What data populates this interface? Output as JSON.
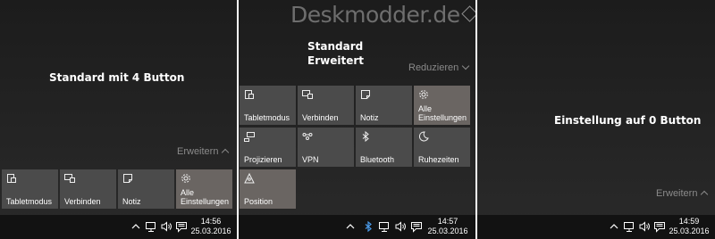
{
  "watermark": "Deskmodder.de",
  "panel1": {
    "caption": "Standard mit 4 Button",
    "expand_label": "Erweitern",
    "tiles": [
      "Tabletmodus",
      "Verbinden",
      "Notiz",
      "Alle Einstellungen"
    ],
    "clock": {
      "time": "14:56",
      "date": "25.03.2016"
    }
  },
  "panel2": {
    "caption_line1": "Standard",
    "caption_line2": "Erweitert",
    "collapse_label": "Reduzieren",
    "tiles": [
      "Tabletmodus",
      "Verbinden",
      "Notiz",
      "Alle Einstellungen",
      "Projizieren",
      "VPN",
      "Bluetooth",
      "Ruhezeiten",
      "Position"
    ],
    "clock": {
      "time": "14:57",
      "date": "25.03.2016"
    }
  },
  "panel3": {
    "caption": "Einstellung auf 0 Button",
    "expand_label": "Erweitern",
    "clock": {
      "time": "14:59",
      "date": "25.03.2016"
    }
  },
  "icons": {
    "tabletmodus": "tablet-mode-icon",
    "verbinden": "connect-icon",
    "notiz": "note-icon",
    "einstellungen": "gear-icon",
    "projizieren": "project-icon",
    "vpn": "vpn-icon",
    "bluetooth": "bluetooth-icon",
    "ruhezeiten": "moon-icon",
    "position": "location-icon",
    "tray": [
      "chevron-up-icon",
      "network-icon",
      "volume-icon",
      "action-center-icon"
    ]
  },
  "colors": {
    "background": "#1f1f1f",
    "tile": "#4b4b4b",
    "tile_active": "#6a6562",
    "taskbar": "#121212",
    "text": "#ffffff",
    "link": "#8a8a8a"
  }
}
